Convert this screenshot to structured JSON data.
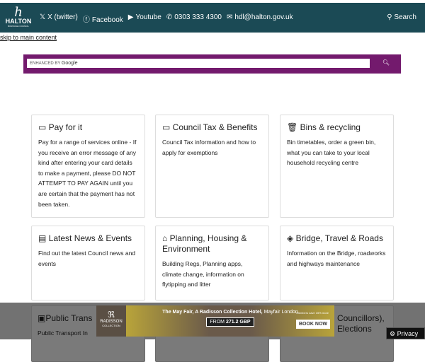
{
  "header": {
    "logo_text": "HALTON",
    "logo_sub": "BOROUGH COUNCIL",
    "twitter": "X (twitter)",
    "facebook": "Facebook",
    "youtube": "Youtube",
    "phone": "0303 333 4300",
    "email": "hdl@halton.gov.uk",
    "search": "Search"
  },
  "skip_link": "skip to main content",
  "google": {
    "enhanced": "ENHANCED BY",
    "brand": "Google"
  },
  "cards": [
    {
      "title": "Pay for it",
      "text": "Pay for a range of services online - If you receive an error message of any kind after entering your card details to make a payment, please DO NOT ATTEMPT TO PAY AGAIN until you are certain that the payment has not been taken.",
      "icon": "card-icon"
    },
    {
      "title": "Council Tax & Benefits",
      "text": "Council Tax information and how to apply for exemptions",
      "icon": "window-icon"
    },
    {
      "title": "Bins & recycling",
      "text": "Bin timetables, order a green bin, what you can take to your local household recycling centre",
      "icon": "bin-icon"
    },
    {
      "title": "Latest News & Events",
      "text": "Find out the latest Council news and events",
      "icon": "newspaper-icon"
    },
    {
      "title": "Planning, Housing & Environment",
      "text": "Building Regs, Planning apps, climate change, information on flytipping and litter",
      "icon": "house-icon"
    },
    {
      "title": "Bridge, Travel & Roads",
      "text": "Information on the Bridge, roadworks and highways maintenance",
      "icon": "sign-icon"
    },
    {
      "title": "Public Trans",
      "text": "Public Transport In",
      "icon": "bus-icon"
    },
    {
      "title": "Councillors), Elections",
      "text": "",
      "icon": ""
    }
  ],
  "ad": {
    "brand": "RADISSON",
    "brand_sub": "COLLECTION",
    "headline": "The May Fair, A Radisson Collection Hotel,",
    "location": "Mayfair London",
    "price_from": "FROM",
    "price": "271.2 GBP",
    "members": "Members save 15% more",
    "cta": "BOOK NOW"
  },
  "privacy": "Privacy"
}
